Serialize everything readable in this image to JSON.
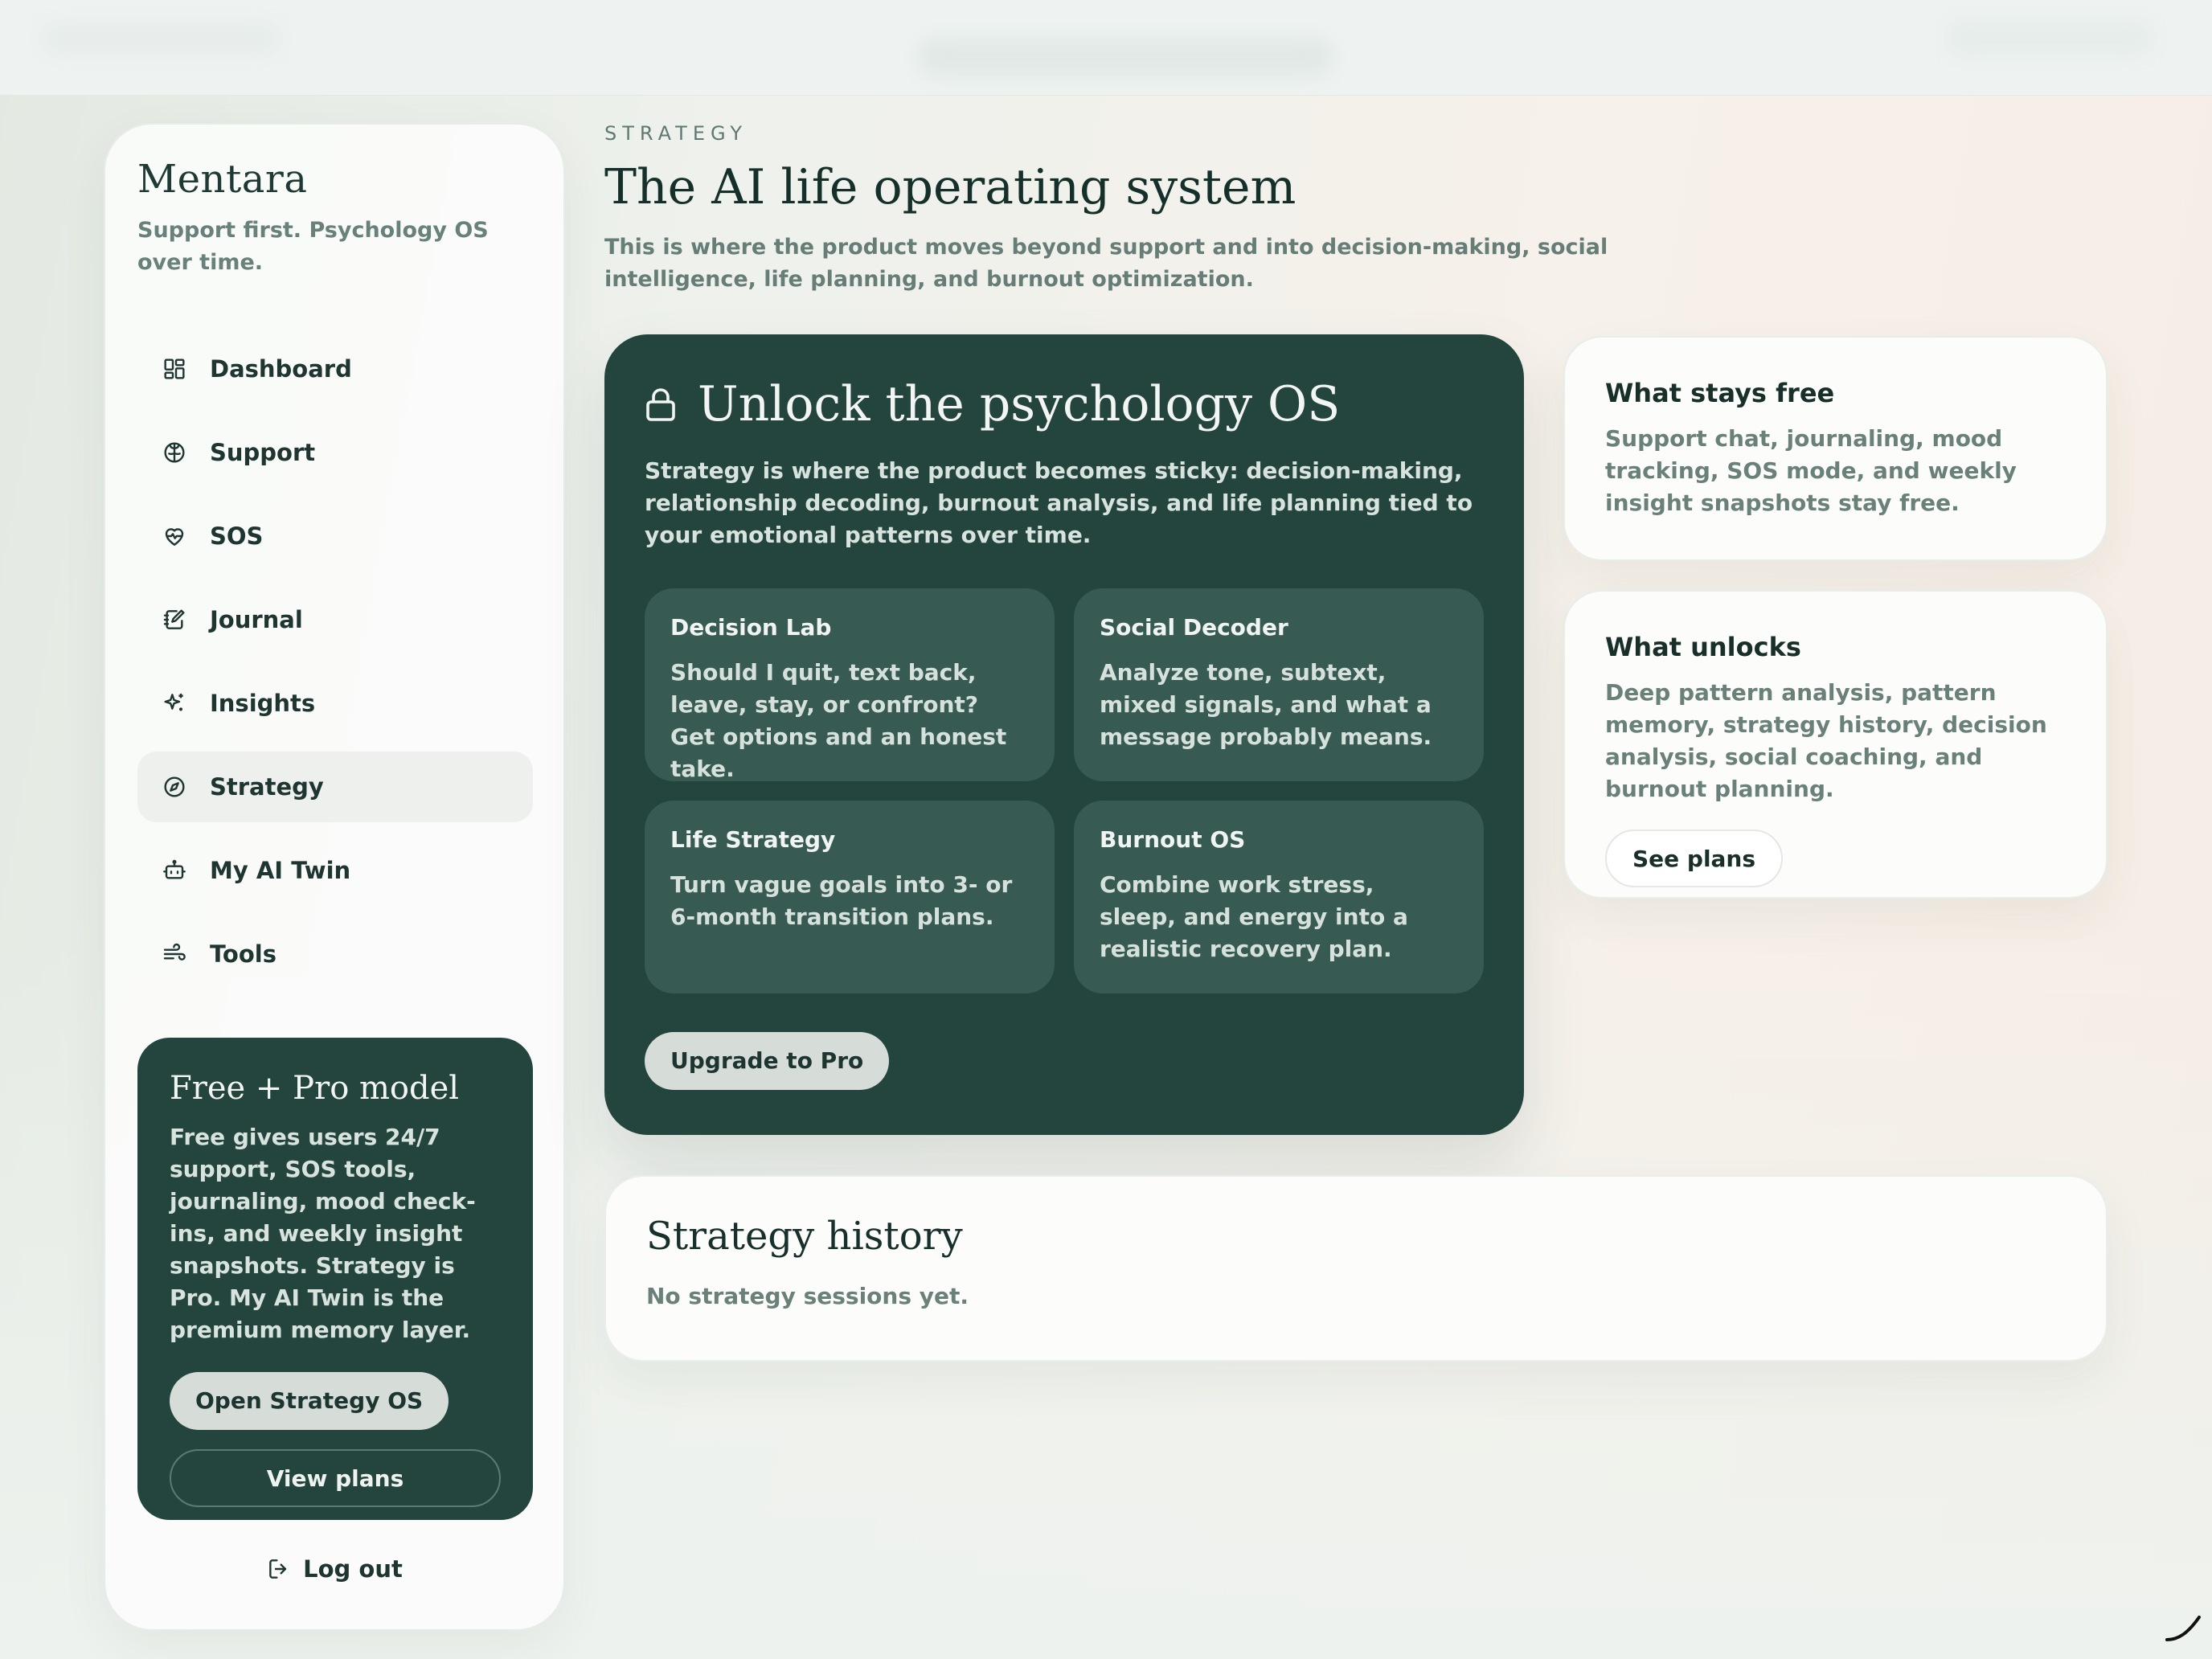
{
  "sidebar": {
    "brand": "Mentara",
    "tagline": "Support first. Psychology OS over time.",
    "items": [
      {
        "label": "Dashboard",
        "icon": "dashboard-icon"
      },
      {
        "label": "Support",
        "icon": "brain-icon"
      },
      {
        "label": "SOS",
        "icon": "heart-pulse-icon"
      },
      {
        "label": "Journal",
        "icon": "journal-icon"
      },
      {
        "label": "Insights",
        "icon": "sparkles-icon"
      },
      {
        "label": "Strategy",
        "icon": "compass-icon",
        "active": true
      },
      {
        "label": "My AI Twin",
        "icon": "robot-icon"
      },
      {
        "label": "Tools",
        "icon": "wind-icon"
      }
    ],
    "promo": {
      "title": "Free + Pro model",
      "text": "Free gives users 24/7 support, SOS tools, journaling, mood check-ins, and weekly insight snapshots. Strategy is Pro. My AI Twin is the premium memory layer.",
      "primary_label": "Open Strategy OS",
      "secondary_label": "View plans"
    },
    "logout_label": "Log out"
  },
  "header": {
    "eyebrow": "STRATEGY",
    "title": "The AI life operating system",
    "subtitle": "This is where the product moves beyond support and into decision-making, social intelligence, life planning, and burnout optimization."
  },
  "hero": {
    "title": "Unlock the psychology OS",
    "text": "Strategy is where the product becomes sticky: decision-making, relationship decoding, burnout analysis, and life planning tied to your emotional patterns over time.",
    "features": [
      {
        "title": "Decision Lab",
        "text": "Should I quit, text back, leave, stay, or confront? Get options and an honest take."
      },
      {
        "title": "Social Decoder",
        "text": "Analyze tone, subtext, mixed signals, and what a message probably means."
      },
      {
        "title": "Life Strategy",
        "text": "Turn vague goals into 3- or 6-month transition plans."
      },
      {
        "title": "Burnout OS",
        "text": "Combine work stress, sleep, and energy into a realistic recovery plan."
      }
    ],
    "cta_label": "Upgrade to Pro"
  },
  "free_card": {
    "title": "What stays free",
    "text": "Support chat, journaling, mood tracking, SOS mode, and weekly insight snapshots stay free."
  },
  "unlock_card": {
    "title": "What unlocks",
    "text": "Deep pattern analysis, pattern memory, strategy history, decision analysis, social coaching, and burnout planning.",
    "button_label": "See plans"
  },
  "history": {
    "title": "Strategy history",
    "empty_text": "No strategy sessions yet."
  },
  "colors": {
    "brand_dark": "#23453e",
    "feature_tile": "#375a52",
    "muted_text": "#6a817a"
  }
}
